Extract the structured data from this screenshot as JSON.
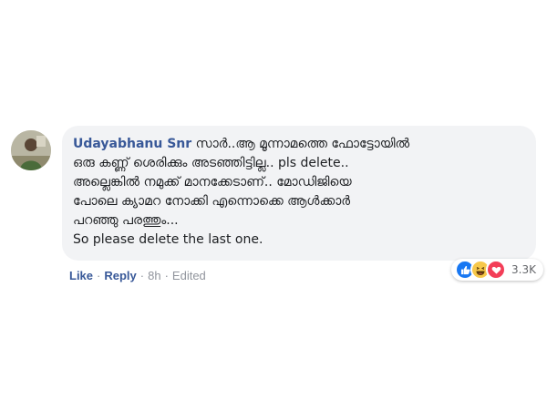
{
  "comment": {
    "author": "Udayabhanu Snr",
    "lines": [
      "സാർ..ആ മൂന്നാമത്തെ ഫോട്ടോയിൽ",
      "ഒരു കണ്ണ് ശെരിക്കും അടഞ്ഞിട്ടില്ല.. pls delete..",
      "അല്ലെങ്കിൽ നമുക്ക് മാനക്കേടാണ്.. മോഡിജിയെ",
      "പോലെ ക്യാമറ നോക്കി എന്നൊക്കെ ആൾക്കാർ",
      "പറഞ്ഞു പരത്തും...",
      "So please delete the last one."
    ]
  },
  "reactions": {
    "icons": [
      "like-icon",
      "haha-icon",
      "love-icon"
    ],
    "count": "3.3K",
    "colors": {
      "like": "#1877f2",
      "haha": "#f7c84b",
      "love": "#f33e58"
    }
  },
  "actions": {
    "like": "Like",
    "reply": "Reply",
    "time": "8h",
    "edited": "Edited",
    "separator": "·"
  },
  "colors": {
    "author": "#385898",
    "bubble_bg": "#f2f3f5",
    "meta": "#90949c"
  }
}
